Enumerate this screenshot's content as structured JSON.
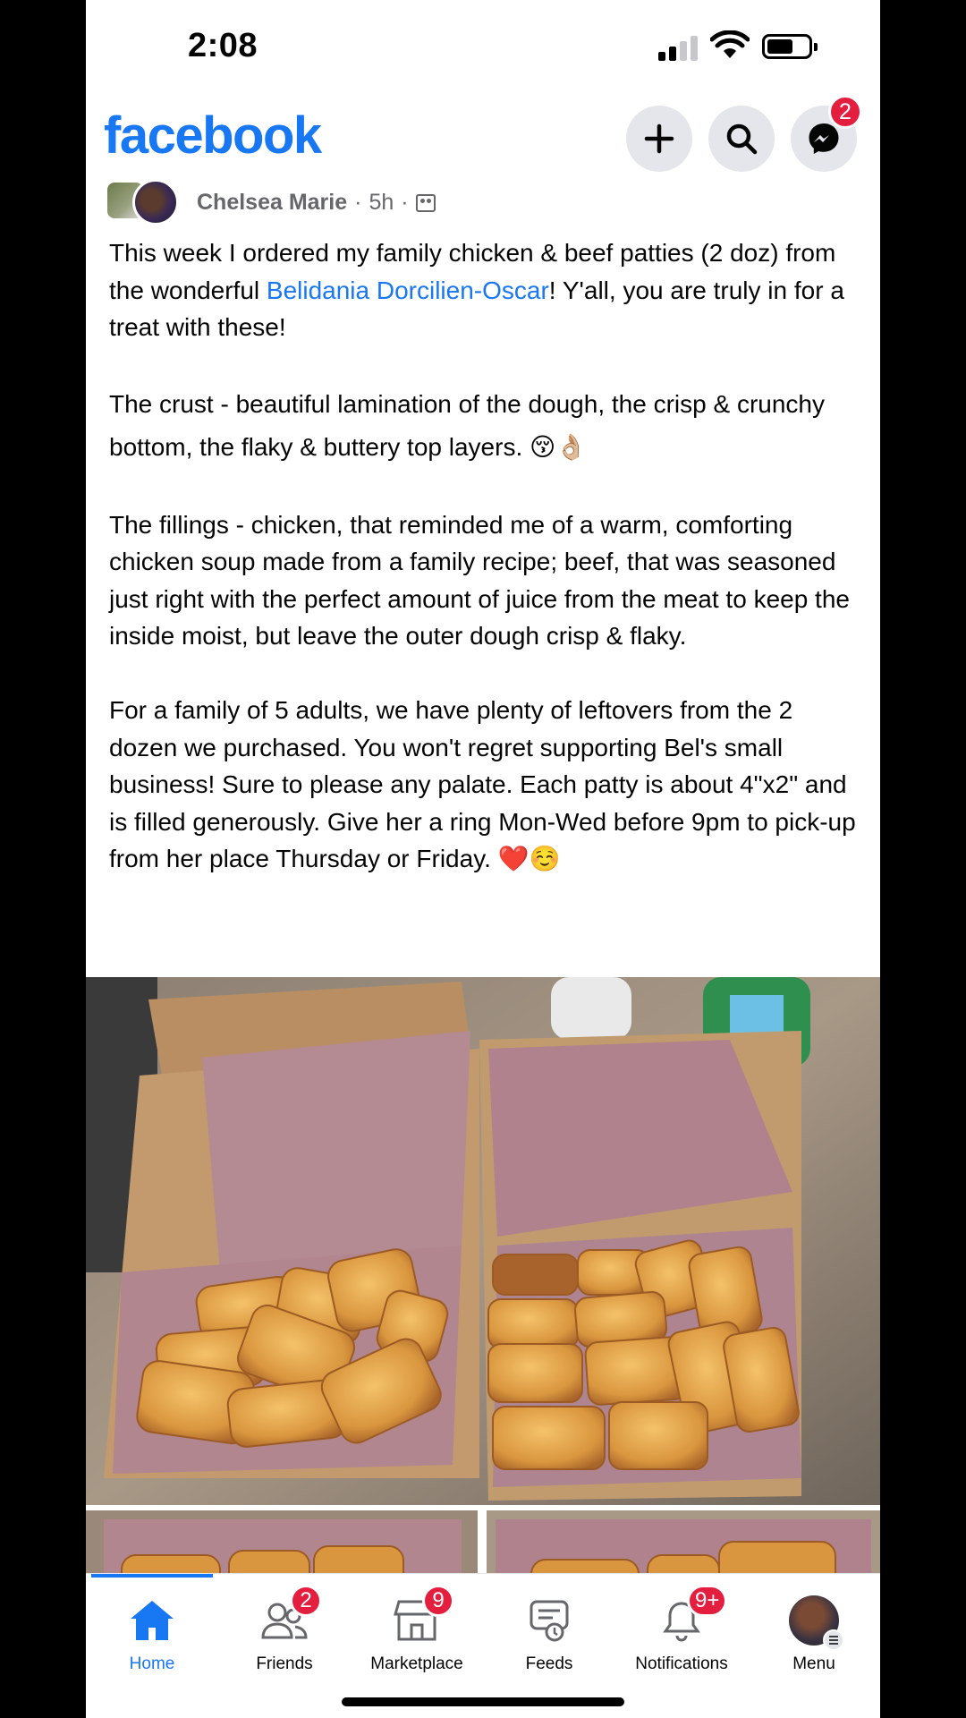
{
  "status_bar": {
    "time": "2:08"
  },
  "header": {
    "logo": "facebook",
    "create_icon": "plus-icon",
    "search_icon": "search-icon",
    "messenger_icon": "messenger-icon",
    "messenger_badge": "2",
    "brand_color": "#1877f2",
    "badge_color": "#e41e3f"
  },
  "post": {
    "author": "Chelsea Marie",
    "time": "5h",
    "separator": "·",
    "audience_icon": "group-icon",
    "paragraph1_before": "This week I ordered my family chicken & beef patties (2 doz) from the wonderful ",
    "mention": "Belidania Dorcilien-Oscar",
    "paragraph1_after": "! Y'all, you are truly in for a treat with these!",
    "paragraph2": "The crust - beautiful lamination of the dough, the crisp & crunchy bottom, the flaky & buttery top layers. 😚👌🏼",
    "paragraph3": "The fillings - chicken, that reminded me of a warm, comforting chicken soup made from a family recipe; beef, that was seasoned just right with the perfect amount of juice from the meat to keep the inside moist, but leave the outer dough crisp & flaky.",
    "paragraph4": "For a family of 5 adults, we have plenty of leftovers from the 2 dozen we purchased. You won't regret supporting Bel's small business! Sure to please any palate. Each patty is about 4\"x2\" and is filled generously. Give her a ring Mon-Wed before 9pm to pick-up from her place Thursday or Friday. ❤️☺️"
  },
  "bottom_nav": {
    "items": [
      {
        "label": "Home",
        "icon": "home-icon",
        "badge": ""
      },
      {
        "label": "Friends",
        "icon": "friends-icon",
        "badge": "2"
      },
      {
        "label": "Marketplace",
        "icon": "marketplace-icon",
        "badge": "9"
      },
      {
        "label": "Feeds",
        "icon": "feeds-icon",
        "badge": ""
      },
      {
        "label": "Notifications",
        "icon": "bell-icon",
        "badge": "9+"
      },
      {
        "label": "Menu",
        "icon": "profile-avatar",
        "badge": ""
      }
    ]
  }
}
